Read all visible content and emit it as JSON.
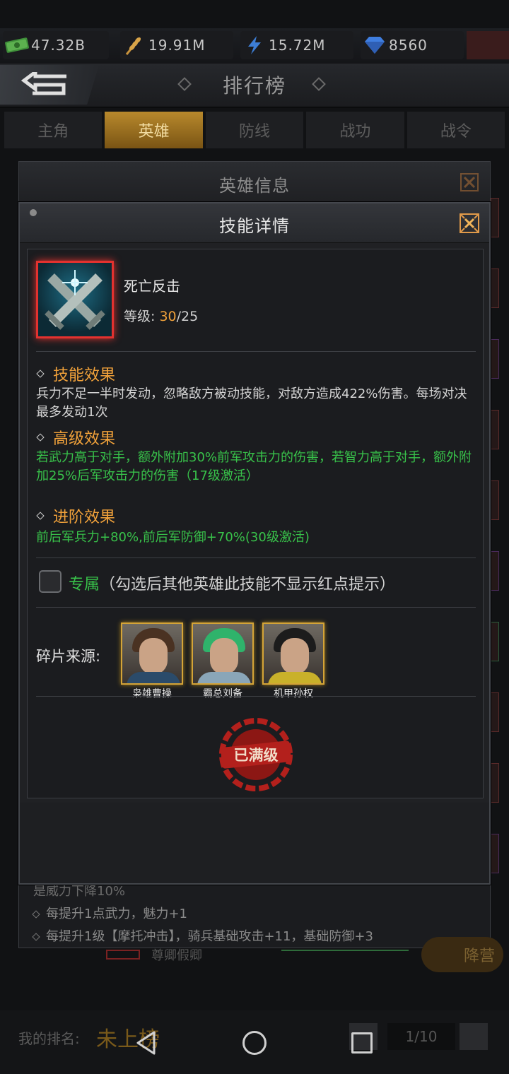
{
  "resources": [
    {
      "icon": "cash-icon",
      "value": "47.32B"
    },
    {
      "icon": "grain-icon",
      "value": "19.91M"
    },
    {
      "icon": "lightning-icon",
      "value": "15.72M"
    },
    {
      "icon": "gem-icon",
      "value": "8560"
    }
  ],
  "header": {
    "title": "排行榜"
  },
  "tabs": [
    {
      "label": "主角",
      "active": false
    },
    {
      "label": "英雄",
      "active": true
    },
    {
      "label": "防线",
      "active": false
    },
    {
      "label": "战功",
      "active": false
    },
    {
      "label": "战令",
      "active": false
    }
  ],
  "hero_dialog": {
    "title": "英雄信息",
    "lines": [
      "是威力下降10%",
      "每提升1点武力，魅力+1",
      "每提升1级【摩托冲击】，骑兵基础攻击+11，基础防御+3"
    ],
    "behind_text": "尊卿假卿",
    "behind_button": "降营"
  },
  "skill_dialog": {
    "title": "技能详情",
    "skill_name": "死亡反击",
    "level_label": "等级:",
    "level_current": "30",
    "level_max": "/25",
    "effect_title": "技能效果",
    "effect_text": "兵力不足一半时发动，忽略敌方被动技能，对敌方造成422%伤害。每场对决最多发动1次",
    "advanced_title": "高级效果",
    "advanced_text": "若武力高于对手，额外附加30%前军攻击力的伤害，若智力高于对手，额外附加25%后军攻击力的伤害（17级激活）",
    "promote_title": "进阶效果",
    "promote_text": "前后军兵力+80%,前后军防御+70%(30级激活)",
    "exclusive_tag": "专属",
    "exclusive_note": "（勾选后其他英雄此技能不显示红点提示）",
    "exclusive_checked": false,
    "fragment_label": "碎片来源:",
    "heroes": [
      {
        "name": "枭雄曹操",
        "hair": "#4a3222",
        "outfit": "#2b4b6a"
      },
      {
        "name": "霸总刘备",
        "hair": "#2fb36b",
        "outfit": "#8aa6b8"
      },
      {
        "name": "机甲孙权",
        "hair": "#1c1c1c",
        "outfit": "#c9b12a"
      }
    ],
    "maxed_label": "已满级"
  },
  "footer": {
    "my_rank_label": "我的排名:",
    "my_rank_value": "未上榜",
    "page": "1/10"
  },
  "colors": {
    "accent": "#f0a13a",
    "green": "#38c24a",
    "frame_red": "#e3322f",
    "gold": "#d4a437"
  }
}
